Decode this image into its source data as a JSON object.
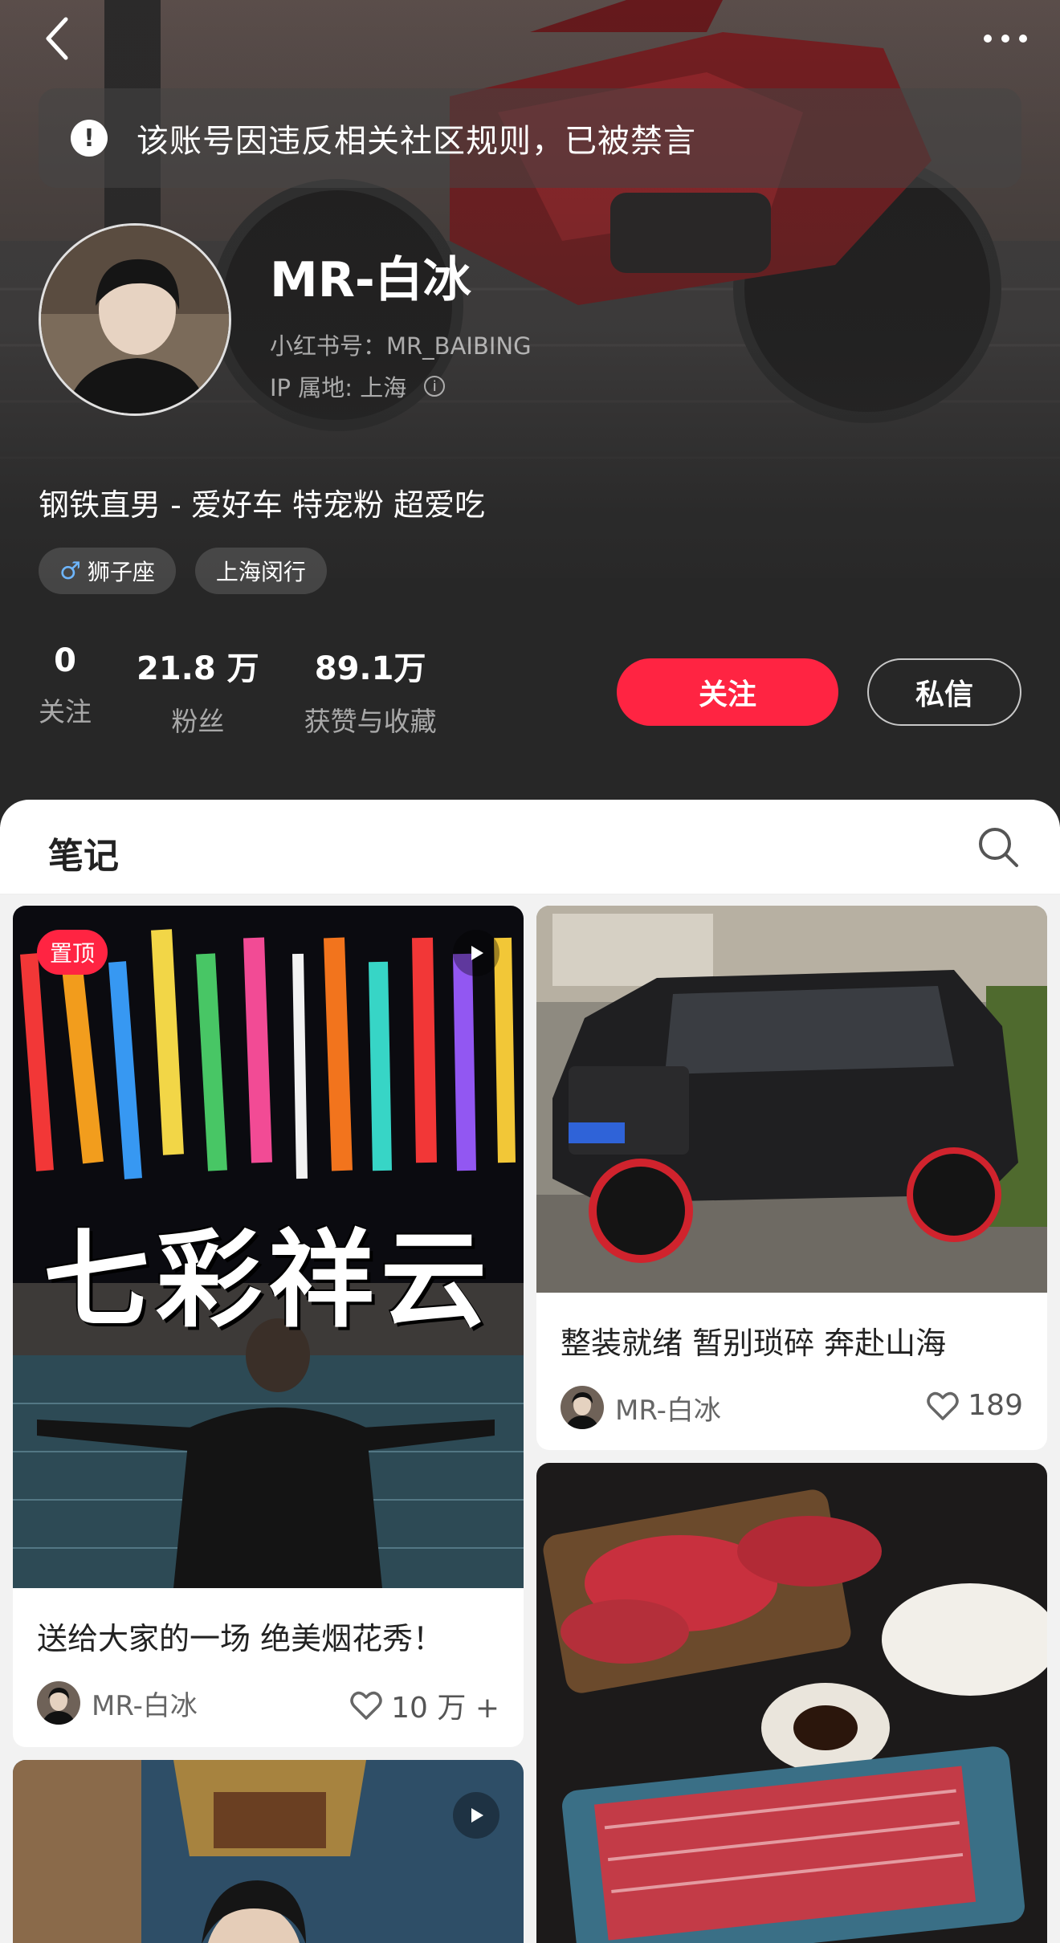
{
  "header": {
    "ban_notice": "该账号因违反相关社区规则，已被禁言",
    "profile_name": "MR-白冰",
    "red_id": "小红书号：MR_BAIBING",
    "ip_location": "IP 属地: 上海",
    "bio": "钢铁直男 - 爱好车 特宠粉 超爱吃",
    "tags": {
      "zodiac": "狮子座",
      "zodiac_gender_symbol": "♂",
      "location": "上海闵行"
    },
    "stats": {
      "following": {
        "value": "0",
        "label": "关注"
      },
      "followers": {
        "value": "21.8 万",
        "label": "粉丝"
      },
      "likes_saves": {
        "value": "89.1万",
        "label": "获赞与收藏"
      }
    },
    "follow_label": "关注",
    "message_label": "私信"
  },
  "tabs": {
    "notes": "笔记"
  },
  "feed": {
    "posts": [
      {
        "pin_label": "置顶",
        "overlay_text": "七彩祥云",
        "title": "送给大家的一场 绝美烟花秀！",
        "author": "MR-白冰",
        "likes": "10 万 +"
      },
      {
        "title": "整装就绪 暂别琐碎 奔赴山海",
        "author": "MR-白冰",
        "likes": "189"
      },
      {
        "title": ""
      },
      {
        "title": ""
      }
    ]
  },
  "icons": {
    "back": "chevron-left-icon",
    "more": "more-dots-icon",
    "ban": "exclamation-icon",
    "info": "info-icon",
    "search": "search-icon",
    "heart": "heart-icon",
    "play": "play-icon"
  },
  "colors": {
    "accent": "#ff2442",
    "header_bg": "#272727"
  }
}
